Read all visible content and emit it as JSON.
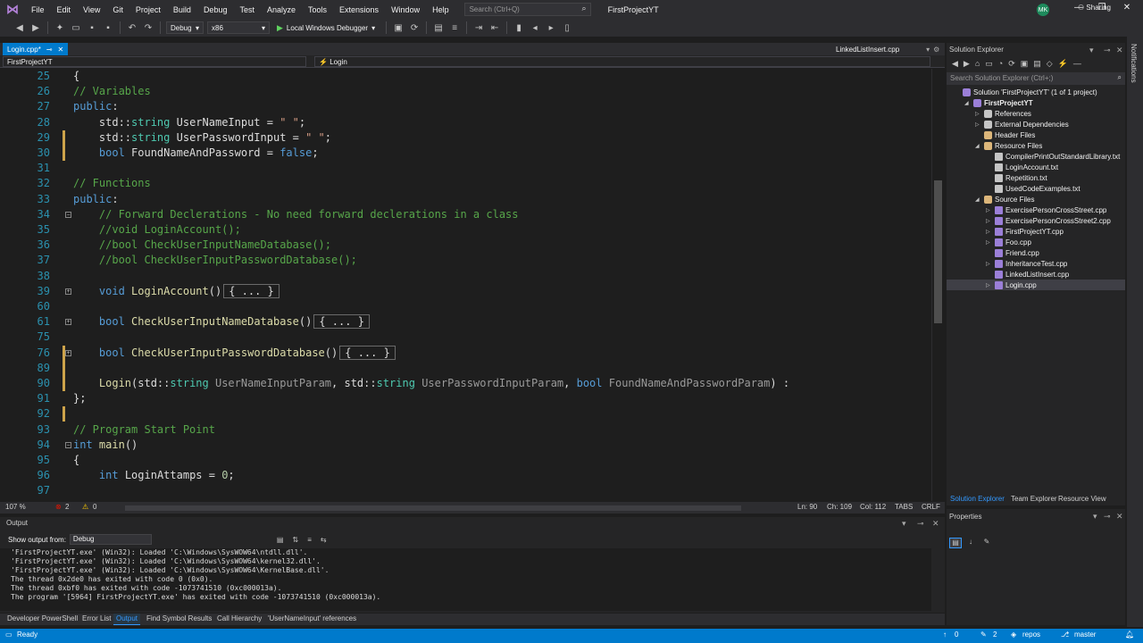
{
  "menu": {
    "items": [
      "File",
      "Edit",
      "View",
      "Git",
      "Project",
      "Build",
      "Debug",
      "Test",
      "Analyze",
      "Tools",
      "Extensions",
      "Window",
      "Help"
    ],
    "search_placeholder": "Search (Ctrl+Q)",
    "project_name": "FirstProjectYT",
    "avatar_initials": "MK"
  },
  "toolbar": {
    "config": "Debug",
    "platform": "x86",
    "run_label": "Local Windows Debugger",
    "sharing": "Sharing"
  },
  "tabs": {
    "active": "Login.cpp*",
    "other": "LinkedListInsert.cpp"
  },
  "navbar": {
    "project": "FirstProjectYT",
    "member": "Login"
  },
  "code": [
    {
      "ln": "25",
      "html": "{"
    },
    {
      "ln": "26",
      "html": "<span class='cm'>// Variables</span>"
    },
    {
      "ln": "27",
      "html": "<span class='kw'>public</span>:"
    },
    {
      "ln": "28",
      "html": "    std::<span class='ty'>string</span> UserNameInput = <span class='st'>\" \"</span>;"
    },
    {
      "ln": "29",
      "html": "    std::<span class='ty'>string</span> UserPasswordInput = <span class='st'>\" \"</span>;"
    },
    {
      "ln": "30",
      "html": "    <span class='kw'>bool</span> FoundNameAndPassword = <span class='kw'>false</span>;"
    },
    {
      "ln": "31",
      "html": ""
    },
    {
      "ln": "32",
      "html": "<span class='cm'>// Functions</span>"
    },
    {
      "ln": "33",
      "html": "<span class='kw'>public</span>:"
    },
    {
      "ln": "34",
      "html": "    <span class='cm'>// Forward Declerations - No need forward declerations in a class</span>"
    },
    {
      "ln": "35",
      "html": "    <span class='cm'>//void LoginAccount();</span>"
    },
    {
      "ln": "36",
      "html": "    <span class='cm'>//bool CheckUserInputNameDatabase();</span>"
    },
    {
      "ln": "37",
      "html": "    <span class='cm'>//bool CheckUserInputPasswordDatabase();</span>"
    },
    {
      "ln": "38",
      "html": ""
    },
    {
      "ln": "39",
      "html": "    <span class='kw'>void</span> <span class='fn'>LoginAccount</span>()<span class='collapsed'>{ ... }</span>"
    },
    {
      "ln": "60",
      "html": ""
    },
    {
      "ln": "61",
      "html": "    <span class='kw'>bool</span> <span class='fn'>CheckUserInputNameDatabase</span>()<span class='collapsed'>{ ... }</span>"
    },
    {
      "ln": "75",
      "html": ""
    },
    {
      "ln": "76",
      "html": "    <span class='kw'>bool</span> <span class='fn'>CheckUserInputPasswordDatabase</span>()<span class='collapsed'>{ ... }</span>"
    },
    {
      "ln": "89",
      "html": ""
    },
    {
      "ln": "90",
      "html": "    <span class='fn'>Login</span>(std::<span class='ty'>string</span> <span class='pr'>UserNameInputParam</span>, std::<span class='ty'>string</span> <span class='pr'>UserPasswordInputParam</span>, <span class='kw'>bool</span> <span class='pr'>FoundNameAndPasswordParam</span>) :"
    },
    {
      "ln": "91",
      "html": "};"
    },
    {
      "ln": "92",
      "html": ""
    },
    {
      "ln": "93",
      "html": "<span class='cm'>// Program Start Point</span>"
    },
    {
      "ln": "94",
      "html": "<span class='kw'>int</span> <span class='fn'>main</span>()"
    },
    {
      "ln": "95",
      "html": "{"
    },
    {
      "ln": "96",
      "html": "    <span class='kw'>int</span> LoginAttamps = <span class='nm'>0</span>;"
    },
    {
      "ln": "97",
      "html": ""
    }
  ],
  "editor_status": {
    "zoom": "107 %",
    "errors": "2",
    "warnings": "0",
    "line": "Ln: 90",
    "ch": "Ch: 109",
    "col": "Col: 112",
    "tabs": "TABS",
    "eol": "CRLF"
  },
  "output": {
    "title": "Output",
    "show_from_label": "Show output from:",
    "source": "Debug",
    "lines": [
      "'FirstProjectYT.exe' (Win32): Loaded 'C:\\Windows\\SysWOW64\\ntdll.dll'.",
      "'FirstProjectYT.exe' (Win32): Loaded 'C:\\Windows\\SysWOW64\\kernel32.dll'.",
      "'FirstProjectYT.exe' (Win32): Loaded 'C:\\Windows\\SysWOW64\\KernelBase.dll'.",
      "The thread 0x2de0 has exited with code 0 (0x0).",
      "The thread 0xbf0 has exited with code -1073741510 (0xc000013a).",
      "The program '[5964] FirstProjectYT.exe' has exited with code -1073741510 (0xc000013a)."
    ]
  },
  "bottom_tabs": [
    "Developer PowerShell",
    "Error List",
    "Output",
    "Find Symbol Results",
    "Call Hierarchy",
    "'UserNameInput' references"
  ],
  "solution_explorer": {
    "title": "Solution Explorer",
    "search_placeholder": "Search Solution Explorer (Ctrl+;)",
    "items": [
      {
        "label": "Solution 'FirstProjectYT' (1 of 1 project)",
        "depth": 0,
        "arrow": ""
      },
      {
        "label": "FirstProjectYT",
        "depth": 1,
        "arrow": "◢"
      },
      {
        "label": "References",
        "depth": 2,
        "arrow": "▷"
      },
      {
        "label": "External Dependencies",
        "depth": 2,
        "arrow": "▷"
      },
      {
        "label": "Header Files",
        "depth": 2,
        "arrow": ""
      },
      {
        "label": "Resource Files",
        "depth": 2,
        "arrow": "◢"
      },
      {
        "label": "CompilerPrintOutStandardLibrary.txt",
        "depth": 3,
        "arrow": ""
      },
      {
        "label": "LoginAccount.txt",
        "depth": 3,
        "arrow": ""
      },
      {
        "label": "Repetition.txt",
        "depth": 3,
        "arrow": ""
      },
      {
        "label": "UsedCodeExamples.txt",
        "depth": 3,
        "arrow": ""
      },
      {
        "label": "Source Files",
        "depth": 2,
        "arrow": "◢"
      },
      {
        "label": "ExercisePersonCrossStreet.cpp",
        "depth": 3,
        "arrow": "▷"
      },
      {
        "label": "ExercisePersonCrossStreet2.cpp",
        "depth": 3,
        "arrow": "▷"
      },
      {
        "label": "FirstProjectYT.cpp",
        "depth": 3,
        "arrow": "▷"
      },
      {
        "label": "Foo.cpp",
        "depth": 3,
        "arrow": "▷"
      },
      {
        "label": "Friend.cpp",
        "depth": 3,
        "arrow": ""
      },
      {
        "label": "InheritanceTest.cpp",
        "depth": 3,
        "arrow": "▷"
      },
      {
        "label": "LinkedListInsert.cpp",
        "depth": 3,
        "arrow": ""
      },
      {
        "label": "Login.cpp",
        "depth": 3,
        "arrow": "▷"
      }
    ],
    "tabs": [
      "Solution Explorer",
      "Team Explorer",
      "Resource View"
    ]
  },
  "properties": {
    "title": "Properties"
  },
  "notifications": "Notifications",
  "statusbar": {
    "ready": "Ready",
    "arrows": "0",
    "pencil": "2",
    "repo": "repos",
    "branch": "master"
  }
}
